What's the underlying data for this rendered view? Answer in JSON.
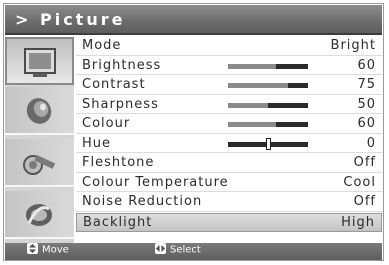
{
  "menu": {
    "title": "> Picture",
    "items": [
      {
        "label": "Mode",
        "value": "Bright"
      },
      {
        "label": "Brightness",
        "value": "60",
        "level": 0.6
      },
      {
        "label": "Contrast",
        "value": "75",
        "level": 0.75
      },
      {
        "label": "Sharpness",
        "value": "50",
        "level": 0.5
      },
      {
        "label": "Colour",
        "value": "60",
        "level": 0.6
      },
      {
        "label": "Hue",
        "value": "0",
        "level": 0.5
      },
      {
        "label": "Fleshtone",
        "value": "Off"
      },
      {
        "label": "Colour Temperature",
        "value": "Cool"
      },
      {
        "label": "Noise Reduction",
        "value": "Off"
      },
      {
        "label": "Backlight",
        "value": "High"
      }
    ]
  },
  "sidebar": {
    "icons": [
      "picture-icon",
      "sound-icon",
      "setup-icon",
      "feature-icon"
    ]
  },
  "footer": {
    "move_label": "Move",
    "select_label": "Select"
  }
}
